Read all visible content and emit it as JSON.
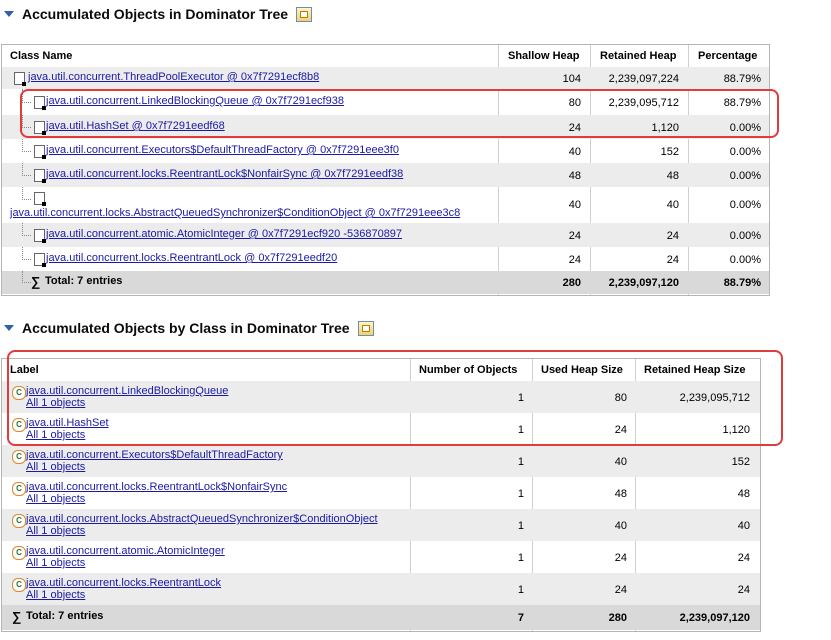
{
  "section1": {
    "title": "Accumulated Objects in Dominator Tree",
    "columns": [
      "Class Name",
      "Shallow Heap",
      "Retained Heap",
      "Percentage"
    ],
    "rows": [
      {
        "name": "java.util.concurrent.ThreadPoolExecutor @ 0x7f7291ecf8b8",
        "shallow": "104",
        "retained": "2,239,097,224",
        "pct": "88.79%"
      },
      {
        "name": "java.util.concurrent.LinkedBlockingQueue @ 0x7f7291ecf938",
        "shallow": "80",
        "retained": "2,239,095,712",
        "pct": "88.79%"
      },
      {
        "name": "java.util.HashSet @ 0x7f7291eedf68",
        "shallow": "24",
        "retained": "1,120",
        "pct": "0.00%"
      },
      {
        "name": "java.util.concurrent.Executors$DefaultThreadFactory @ 0x7f7291eee3f0",
        "shallow": "40",
        "retained": "152",
        "pct": "0.00%"
      },
      {
        "name": "java.util.concurrent.locks.ReentrantLock$NonfairSync @ 0x7f7291eedf38",
        "shallow": "48",
        "retained": "48",
        "pct": "0.00%"
      },
      {
        "name": "java.util.concurrent.locks.AbstractQueuedSynchronizer$ConditionObject @ 0x7f7291eee3c8",
        "shallow": "40",
        "retained": "40",
        "pct": "0.00%"
      },
      {
        "name": "java.util.concurrent.atomic.AtomicInteger @ 0x7f7291ecf920 -536870897",
        "shallow": "24",
        "retained": "24",
        "pct": "0.00%"
      },
      {
        "name": "java.util.concurrent.locks.ReentrantLock @ 0x7f7291eedf20",
        "shallow": "24",
        "retained": "24",
        "pct": "0.00%"
      }
    ],
    "total": {
      "label": "Total: 7 entries",
      "shallow": "280",
      "retained": "2,239,097,120",
      "pct": "88.79%"
    }
  },
  "section2": {
    "title": "Accumulated Objects by Class in Dominator Tree",
    "columns": [
      "Label",
      "Number of Objects",
      "Used Heap Size",
      "Retained Heap Size"
    ],
    "rows": [
      {
        "label": "java.util.concurrent.LinkedBlockingQueue",
        "sub": "All 1 objects",
        "count": "1",
        "used": "80",
        "retained": "2,239,095,712"
      },
      {
        "label": "java.util.HashSet",
        "sub": "All 1 objects",
        "count": "1",
        "used": "24",
        "retained": "1,120"
      },
      {
        "label": "java.util.concurrent.Executors$DefaultThreadFactory",
        "sub": "All 1 objects",
        "count": "1",
        "used": "40",
        "retained": "152"
      },
      {
        "label": "java.util.concurrent.locks.ReentrantLock$NonfairSync",
        "sub": "All 1 objects",
        "count": "1",
        "used": "48",
        "retained": "48"
      },
      {
        "label": "java.util.concurrent.locks.AbstractQueuedSynchronizer$ConditionObject",
        "sub": "All 1 objects",
        "count": "1",
        "used": "40",
        "retained": "40"
      },
      {
        "label": "java.util.concurrent.atomic.AtomicInteger",
        "sub": "All 1 objects",
        "count": "1",
        "used": "24",
        "retained": "24"
      },
      {
        "label": "java.util.concurrent.locks.ReentrantLock",
        "sub": "All 1 objects",
        "count": "1",
        "used": "24",
        "retained": "24"
      }
    ],
    "total": {
      "label": "Total: 7 entries",
      "count": "7",
      "used": "280",
      "retained": "2,239,097,120"
    }
  },
  "icons": {
    "section_toggle": "triangle-down-icon",
    "export": "export-icon",
    "object": "object-file-icon",
    "class": "class-icon",
    "sum": "sigma-icon"
  },
  "colors": {
    "highlight": "#e23b3b",
    "link": "#1a1aa6",
    "alt_row": "#ececec",
    "total_row": "#d9d9d9"
  }
}
